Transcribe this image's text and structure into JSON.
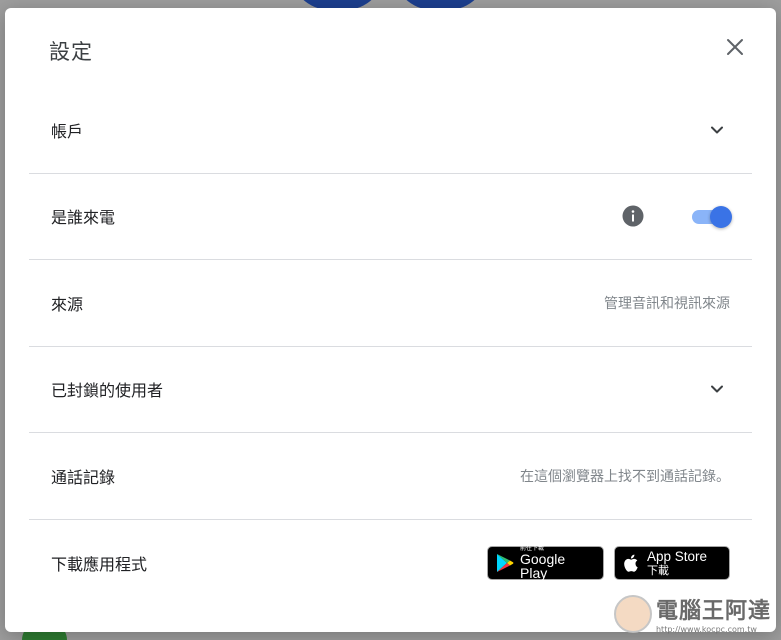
{
  "dialog": {
    "title": "設定",
    "close_icon": "close-icon"
  },
  "rows": [
    {
      "label": "帳戶",
      "control": "chevron-down-icon"
    },
    {
      "label": "是誰來電",
      "control": "toggle",
      "toggle_on": true,
      "info_icon": "info-icon"
    },
    {
      "label": "來源",
      "hint": "管理音訊和視訊來源"
    },
    {
      "label": "已封鎖的使用者",
      "control": "chevron-down-icon"
    },
    {
      "label": "通話記錄",
      "hint": "在這個瀏覽器上找不到通話記錄。"
    },
    {
      "label": "下載應用程式"
    }
  ],
  "badges": {
    "google_play": {
      "small": "前往下載",
      "big": "Google Play"
    },
    "app_store": {
      "big": "App Store",
      "sub": "下載"
    }
  },
  "watermark": {
    "title": "電腦王阿達",
    "url": "http://www.kocpc.com.tw"
  },
  "colors": {
    "toggle_thumb": "#3a73e6",
    "toggle_track": "#8ab4f8",
    "divider": "#dadce0"
  }
}
